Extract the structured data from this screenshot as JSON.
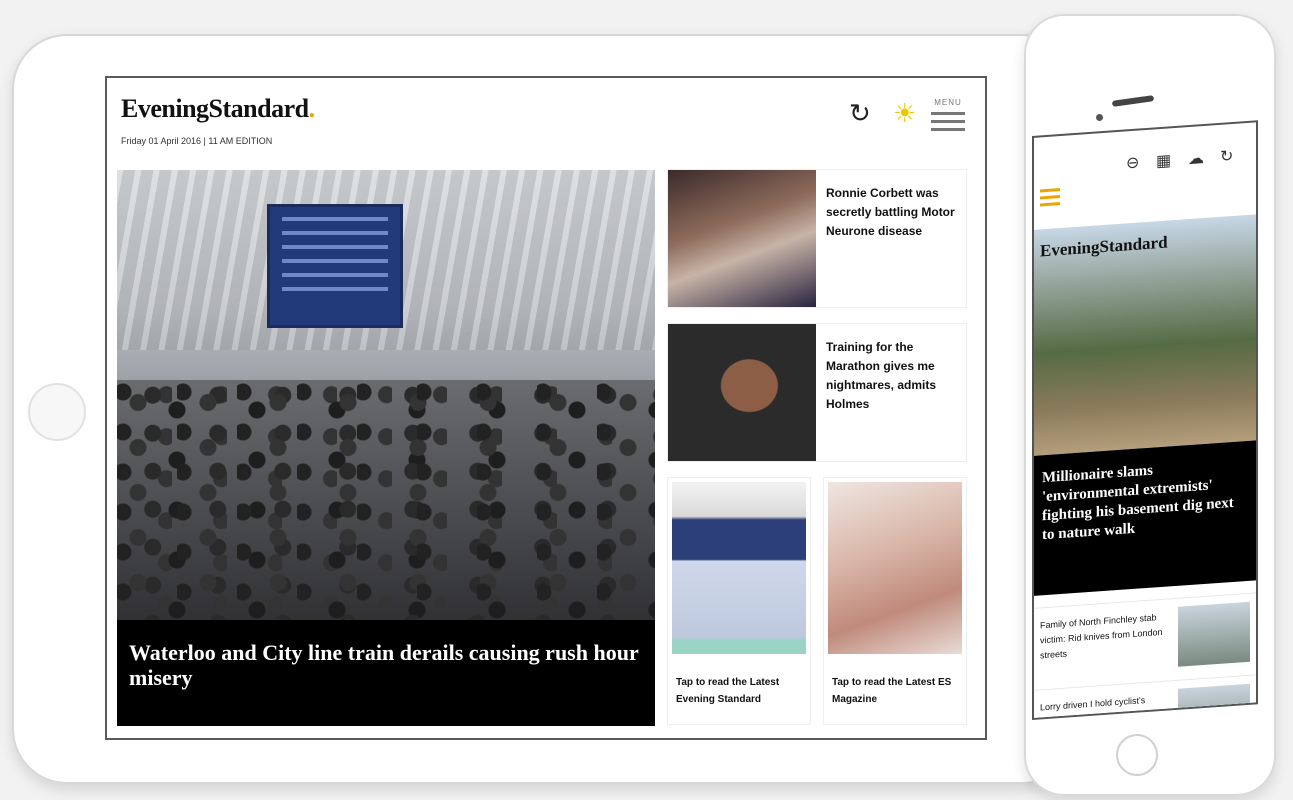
{
  "ipad": {
    "logo": "EveningStandard",
    "logo_dot": ".",
    "edition": "Friday 01 April 2016 | 11 AM EDITION",
    "toolbar": {
      "refresh_icon": "refresh-icon",
      "brightness_icon": "sun-icon",
      "menu_label": "MENU"
    },
    "hero": {
      "headline": "Waterloo and City line train derails causing rush hour misery"
    },
    "stories": [
      {
        "headline": "Ronnie Corbett was secretly battling Motor Neurone disease"
      },
      {
        "headline": "Training for the Marathon gives me nightmares, admits Holmes"
      }
    ],
    "promos": [
      {
        "text": "Tap to read the Latest Evening Standard"
      },
      {
        "text": "Tap to read the Latest ES Magazine"
      }
    ]
  },
  "phone": {
    "logo": "EveningStandard",
    "toolbar_icons": [
      "glasses-icon",
      "calendar-icon",
      "cloud-icon",
      "refresh-icon"
    ],
    "hero": {
      "headline": "Millionaire slams 'environmental extremists' fighting his basement dig next to nature walk"
    },
    "list": [
      {
        "text": "Family of North Finchley stab victim: Rid knives from London streets"
      },
      {
        "text": "Lorry driven I hold cyclist's"
      }
    ]
  },
  "colors": {
    "accent_gold": "#e6a600",
    "caption_bg": "#000000",
    "sun": "#f2c500"
  }
}
